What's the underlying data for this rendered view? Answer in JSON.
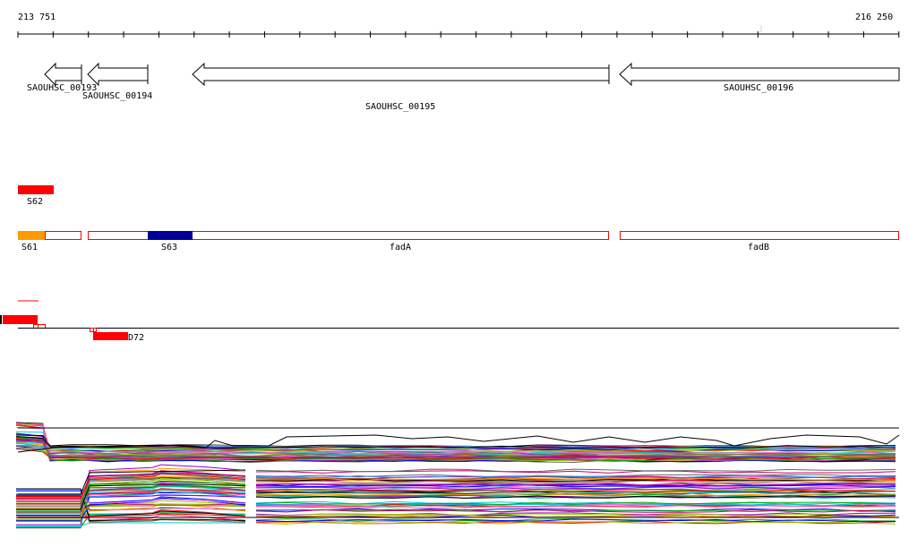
{
  "ruler": {
    "start": "213 751",
    "end": "216 250",
    "ticks": 26
  },
  "genes": [
    {
      "id": "SAOUHSC_00193",
      "strand": "-"
    },
    {
      "id": "SAOUHSC_00194",
      "strand": "-"
    },
    {
      "id": "SAOUHSC_00195",
      "strand": "-"
    },
    {
      "id": "SAOUHSC_00196",
      "strand": "-"
    }
  ],
  "features": {
    "s62": "S62",
    "s61": "S61",
    "s63": "S63",
    "fadA": "fadA",
    "fadB": "fadB",
    "d72": "D72"
  },
  "colors": {
    "red": "#ff0000",
    "orange": "#ff9900",
    "navy": "#000099"
  },
  "coverage_palette": [
    "#000000",
    "#ff0000",
    "#00aa00",
    "#0000ff",
    "#ff9900",
    "#9900cc",
    "#00cccc",
    "#cc0066",
    "#666666",
    "#99cc00",
    "#3399ff",
    "#996633",
    "#ff66cc"
  ]
}
